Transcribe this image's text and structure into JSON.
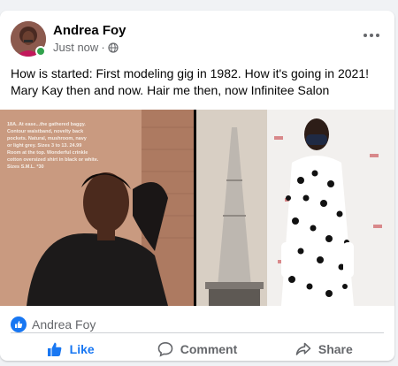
{
  "post": {
    "author": "Andrea Foy",
    "timestamp": "Just now",
    "audience_icon": "globe-icon",
    "text_line1": "How is started: First modeling gig in 1982. How it's going in 2021!",
    "text_line2": "Mary Kay then and now. Hair me then, now Infinitee Salon"
  },
  "photos": {
    "left": {
      "caption_lines": [
        "18A. At ease...the gathered baggy.",
        "Contour waistband, novelty back",
        "pockets. Natural, mushroom, navy",
        "or light grey. Sizes 3 to 13. 24.99",
        "Room at the top. Wonderful crinkle",
        "cotton oversized shirt in black or white.",
        "Sizes S.M.L. *30"
      ]
    }
  },
  "reactions": {
    "icon": "like-icon",
    "names": "Andrea Foy"
  },
  "actions": {
    "like_label": "Like",
    "comment_label": "Comment",
    "share_label": "Share"
  },
  "colors": {
    "brand": "#1877f2",
    "secondary_text": "#65676b",
    "online": "#31a24c"
  }
}
